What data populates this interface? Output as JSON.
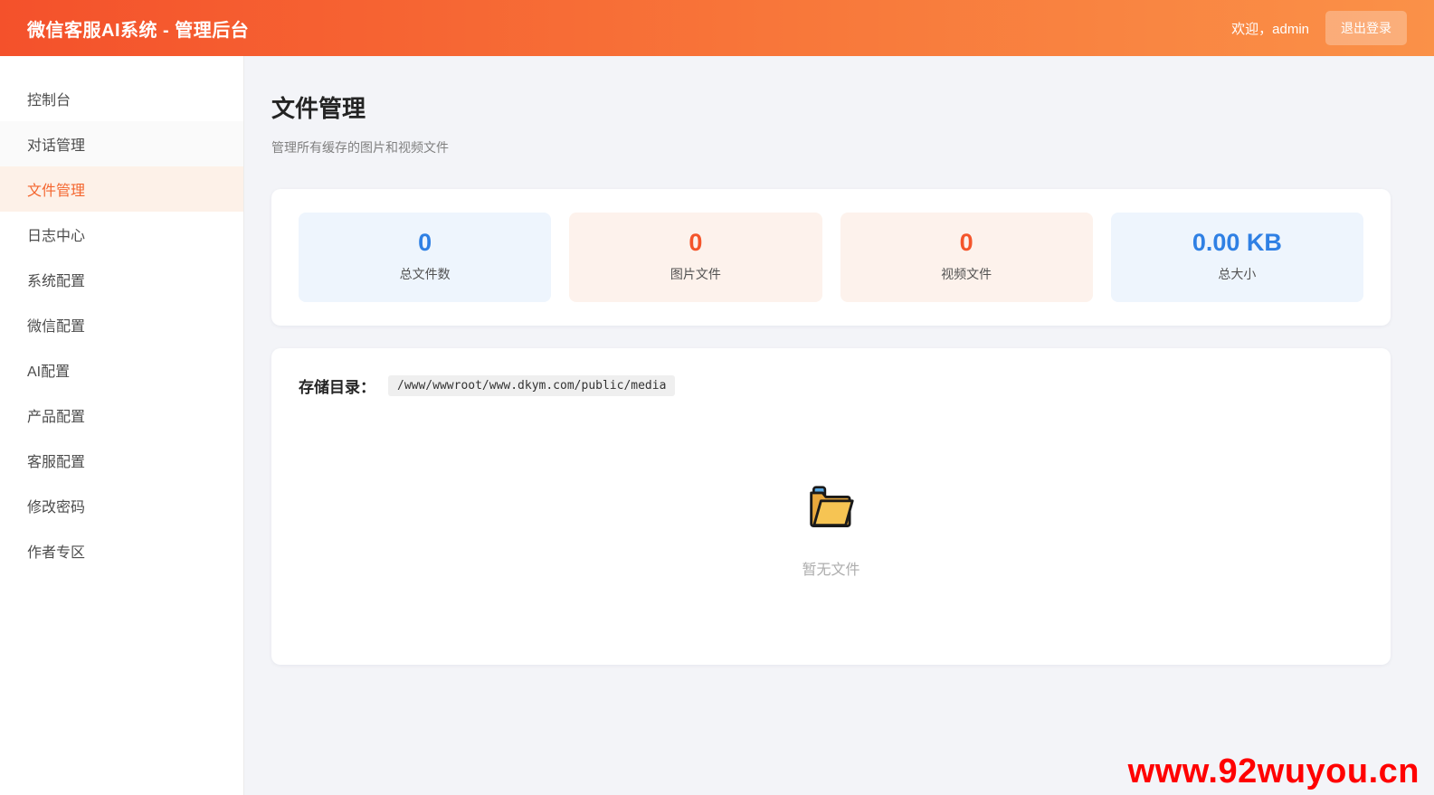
{
  "header": {
    "title": "微信客服AI系统 - 管理后台",
    "welcome": "欢迎，admin",
    "logout_label": "退出登录"
  },
  "sidebar": {
    "items": [
      {
        "label": "控制台",
        "active": false
      },
      {
        "label": "对话管理",
        "active": false
      },
      {
        "label": "文件管理",
        "active": true
      },
      {
        "label": "日志中心",
        "active": false
      },
      {
        "label": "系统配置",
        "active": false
      },
      {
        "label": "微信配置",
        "active": false
      },
      {
        "label": "AI配置",
        "active": false
      },
      {
        "label": "产品配置",
        "active": false
      },
      {
        "label": "客服配置",
        "active": false
      },
      {
        "label": "修改密码",
        "active": false
      },
      {
        "label": "作者专区",
        "active": false
      }
    ]
  },
  "page": {
    "title": "文件管理",
    "subtitle": "管理所有缓存的图片和视频文件"
  },
  "stats": [
    {
      "value": "0",
      "label": "总文件数",
      "color": "blue"
    },
    {
      "value": "0",
      "label": "图片文件",
      "color": "orange"
    },
    {
      "value": "0",
      "label": "视频文件",
      "color": "orange"
    },
    {
      "value": "0.00 KB",
      "label": "总大小",
      "color": "blue"
    }
  ],
  "storage": {
    "label": "存储目录：",
    "path": "/www/wwwroot/www.dkym.com/public/media"
  },
  "empty_state": {
    "icon": "open-folder-icon",
    "text": "暂无文件"
  },
  "watermark": "www.92wuyou.cn",
  "colors": {
    "header_gradient_start": "#f4512b",
    "header_gradient_end": "#fa9148",
    "accent_orange": "#f4552b",
    "accent_blue": "#2f80e4",
    "stat_blue_bg": "#eef5fd",
    "stat_orange_bg": "#fdf2ec",
    "active_item_bg": "#fdf1e8",
    "active_item_text": "#f4662f",
    "page_bg": "#f3f4f8",
    "watermark_red": "#ff0000"
  }
}
